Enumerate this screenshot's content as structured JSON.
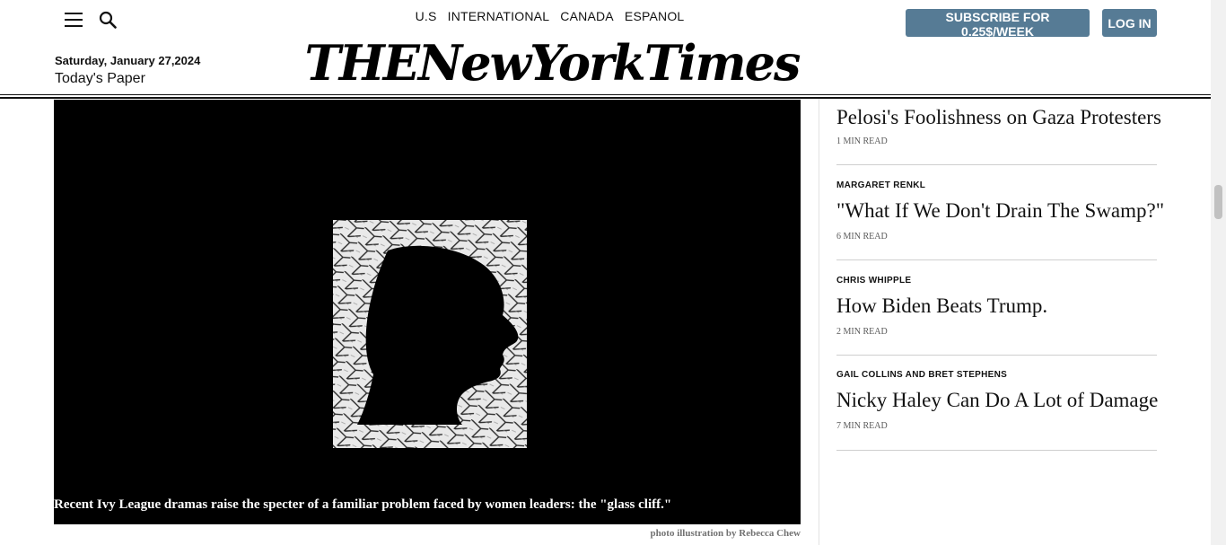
{
  "header": {
    "edition_links": [
      "U.S",
      "INTERNATIONAL",
      "CANADA",
      "ESPANOL"
    ],
    "subscribe_label": "SUBSCRIBE FOR 0.25$/WEEK",
    "login_label": "LOG IN",
    "date": "Saturday, January 27,2024",
    "todays_paper": "Today's Paper",
    "masthead": "THENewYorkTimes",
    "icons": {
      "menu": "hamburger-menu-icon",
      "search": "search-icon"
    },
    "button_color": "#567b95"
  },
  "lead": {
    "caption": "Recent Ivy League dramas raise the specter of a familiar problem faced by women leaders: the \"glass cliff.\"",
    "credit": "photo illustration by Rebecca Chew"
  },
  "opinions": [
    {
      "author": "",
      "title": "Pelosi's Foolishness on Gaza Protesters",
      "read_time": "1 MIN READ"
    },
    {
      "author": "MARGARET RENKL",
      "title": "\"What If We Don't Drain The Swamp?\"",
      "read_time": "6 MIN READ"
    },
    {
      "author": "CHRIS WHIPPLE",
      "title": "How Biden Beats Trump.",
      "read_time": "2 MIN READ"
    },
    {
      "author": "GAIL COLLINS AND BRET STEPHENS",
      "title": "Nicky Haley Can Do A Lot of Damage",
      "read_time": "7 MIN READ"
    }
  ]
}
